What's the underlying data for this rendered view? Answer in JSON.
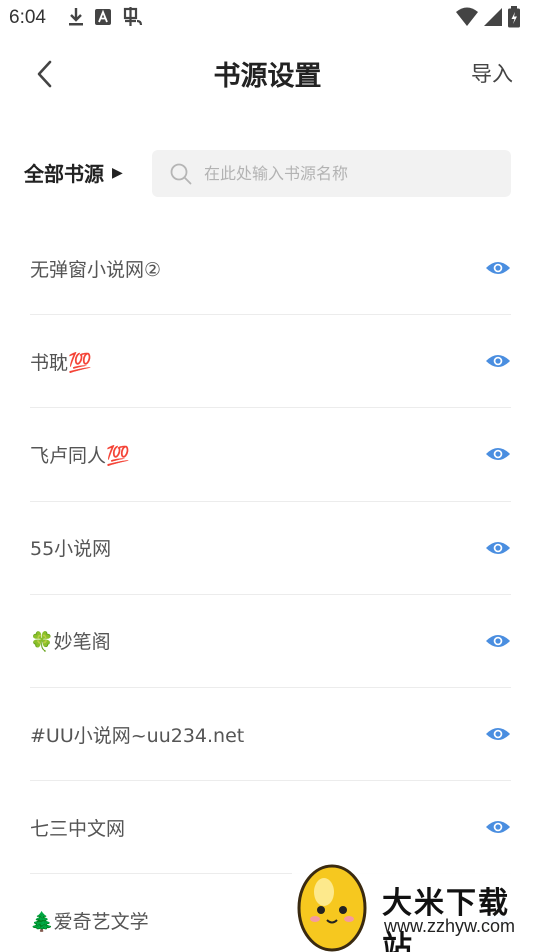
{
  "status_bar": {
    "time": "6:04",
    "icons_left": [
      "download-icon",
      "a-app-icon",
      "bug-icon"
    ],
    "icons_right": [
      "wifi-icon",
      "signal-icon",
      "battery-icon"
    ]
  },
  "toolbar": {
    "back_icon": "chevron-left-icon",
    "title": "书源设置",
    "import_label": "导入"
  },
  "filter": {
    "label": "全部书源",
    "arrow": "▶",
    "search_placeholder": "在此处输入书源名称",
    "search_value": ""
  },
  "sources": [
    {
      "name": "无弹窗小说网②",
      "visible": true
    },
    {
      "name": "书耽💯",
      "visible": true
    },
    {
      "name": "飞卢同人💯",
      "visible": true
    },
    {
      "name": "55小说网",
      "visible": true
    },
    {
      "name": "🍀妙笔阁",
      "visible": true
    },
    {
      "name": "#UU小说网~uu234.net",
      "visible": true
    },
    {
      "name": "七三中文网",
      "visible": true
    },
    {
      "name": "🌲爱奇艺文学",
      "visible": true
    }
  ],
  "watermark": {
    "title": "大米下载站",
    "url": "www.zzhyw.com"
  },
  "colors": {
    "accent": "#4a8ee0",
    "text": "#555555",
    "divider": "#ececec",
    "search_bg": "#f2f2f2"
  }
}
